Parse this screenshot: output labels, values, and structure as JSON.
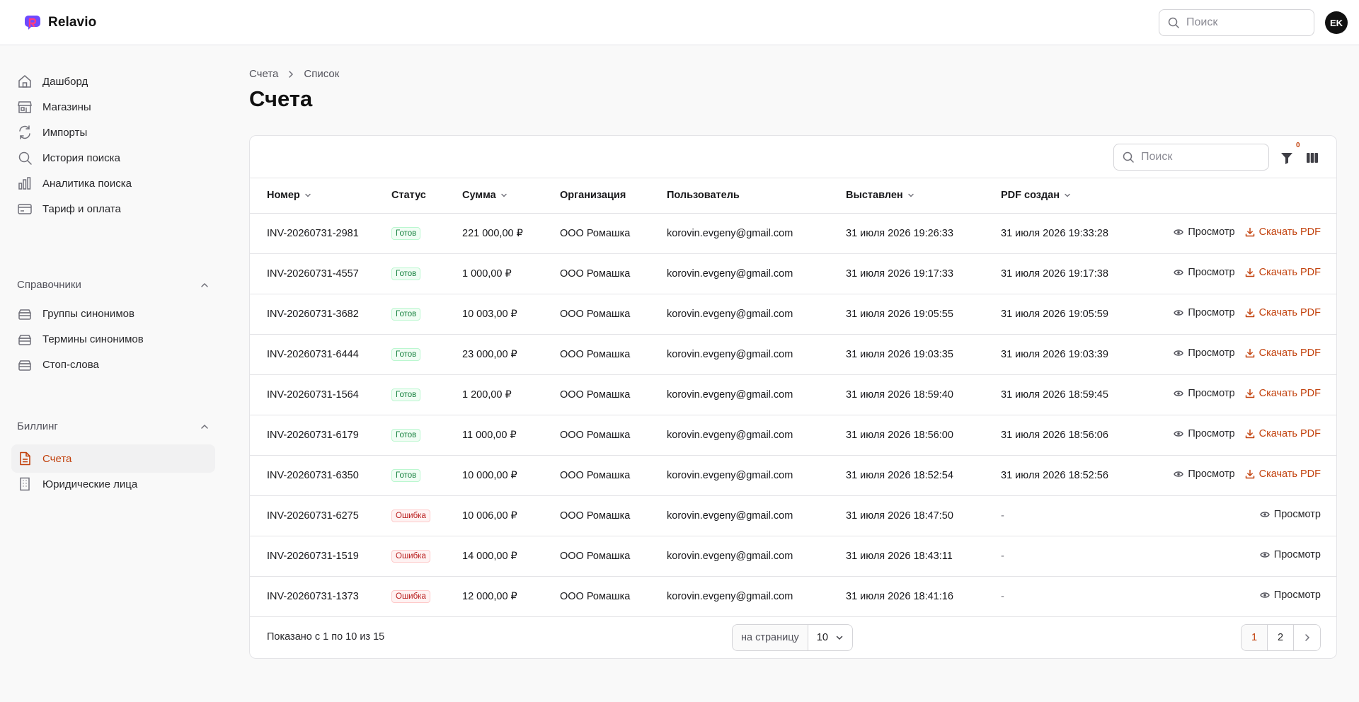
{
  "app": {
    "name": "Relavio",
    "user_initials": "EK"
  },
  "header": {
    "search_placeholder": "Поиск"
  },
  "sidebar": {
    "main_items": [
      {
        "label": "Дашборд",
        "icon": "home-icon"
      },
      {
        "label": "Магазины",
        "icon": "store-icon"
      },
      {
        "label": "Импорты",
        "icon": "refresh-icon"
      },
      {
        "label": "История поиска",
        "icon": "search-icon"
      },
      {
        "label": "Аналитика поиска",
        "icon": "bar-chart-icon"
      },
      {
        "label": "Тариф и оплата",
        "icon": "credit-card-icon"
      }
    ],
    "sections": [
      {
        "title": "Справочники",
        "items": [
          {
            "label": "Группы синонимов",
            "icon": "database-icon"
          },
          {
            "label": "Термины синонимов",
            "icon": "database-icon"
          },
          {
            "label": "Стоп-слова",
            "icon": "database-icon"
          }
        ]
      },
      {
        "title": "Биллинг",
        "items": [
          {
            "label": "Счета",
            "icon": "file-text-icon",
            "active": true
          },
          {
            "label": "Юридические лица",
            "icon": "building-icon"
          }
        ]
      }
    ]
  },
  "breadcrumb": [
    "Счета",
    "Список"
  ],
  "page_title": "Счета",
  "table": {
    "search_placeholder": "Поиск",
    "filter_count": "0",
    "columns": [
      "Номер",
      "Статус",
      "Сумма",
      "Организация",
      "Пользователь",
      "Выставлен",
      "PDF создан"
    ],
    "view_label": "Просмотр",
    "pdf_label": "Скачать PDF",
    "rows": [
      {
        "number": "INV-20260731-2981",
        "status": "Готов",
        "status_kind": "ok",
        "amount": "221 000,00 ₽",
        "org": "ООО Ромашка",
        "user": "korovin.evgeny@gmail.com",
        "issued": "31 июля 2026 19:26:33",
        "pdf": "31 июля 2026 19:33:28"
      },
      {
        "number": "INV-20260731-4557",
        "status": "Готов",
        "status_kind": "ok",
        "amount": "1 000,00 ₽",
        "org": "ООО Ромашка",
        "user": "korovin.evgeny@gmail.com",
        "issued": "31 июля 2026 19:17:33",
        "pdf": "31 июля 2026 19:17:38"
      },
      {
        "number": "INV-20260731-3682",
        "status": "Готов",
        "status_kind": "ok",
        "amount": "10 003,00 ₽",
        "org": "ООО Ромашка",
        "user": "korovin.evgeny@gmail.com",
        "issued": "31 июля 2026 19:05:55",
        "pdf": "31 июля 2026 19:05:59"
      },
      {
        "number": "INV-20260731-6444",
        "status": "Готов",
        "status_kind": "ok",
        "amount": "23 000,00 ₽",
        "org": "ООО Ромашка",
        "user": "korovin.evgeny@gmail.com",
        "issued": "31 июля 2026 19:03:35",
        "pdf": "31 июля 2026 19:03:39"
      },
      {
        "number": "INV-20260731-1564",
        "status": "Готов",
        "status_kind": "ok",
        "amount": "1 200,00 ₽",
        "org": "ООО Ромашка",
        "user": "korovin.evgeny@gmail.com",
        "issued": "31 июля 2026 18:59:40",
        "pdf": "31 июля 2026 18:59:45"
      },
      {
        "number": "INV-20260731-6179",
        "status": "Готов",
        "status_kind": "ok",
        "amount": "11 000,00 ₽",
        "org": "ООО Ромашка",
        "user": "korovin.evgeny@gmail.com",
        "issued": "31 июля 2026 18:56:00",
        "pdf": "31 июля 2026 18:56:06"
      },
      {
        "number": "INV-20260731-6350",
        "status": "Готов",
        "status_kind": "ok",
        "amount": "10 000,00 ₽",
        "org": "ООО Ромашка",
        "user": "korovin.evgeny@gmail.com",
        "issued": "31 июля 2026 18:52:54",
        "pdf": "31 июля 2026 18:52:56"
      },
      {
        "number": "INV-20260731-6275",
        "status": "Ошибка",
        "status_kind": "err",
        "amount": "10 006,00 ₽",
        "org": "ООО Ромашка",
        "user": "korovin.evgeny@gmail.com",
        "issued": "31 июля 2026 18:47:50",
        "pdf": "-"
      },
      {
        "number": "INV-20260731-1519",
        "status": "Ошибка",
        "status_kind": "err",
        "amount": "14 000,00 ₽",
        "org": "ООО Ромашка",
        "user": "korovin.evgeny@gmail.com",
        "issued": "31 июля 2026 18:43:11",
        "pdf": "-"
      },
      {
        "number": "INV-20260731-1373",
        "status": "Ошибка",
        "status_kind": "err",
        "amount": "12 000,00 ₽",
        "org": "ООО Ромашка",
        "user": "korovin.evgeny@gmail.com",
        "issued": "31 июля 2026 18:41:16",
        "pdf": "-"
      }
    ]
  },
  "footer": {
    "shown_text": "Показано с 1 по 10 из 15",
    "per_page_label": "на страницу",
    "per_page_value": "10",
    "pages": [
      "1",
      "2"
    ],
    "current_page": "1"
  },
  "colors": {
    "accent": "#c2410c",
    "ok": "#15803d",
    "error": "#b91c1c"
  }
}
